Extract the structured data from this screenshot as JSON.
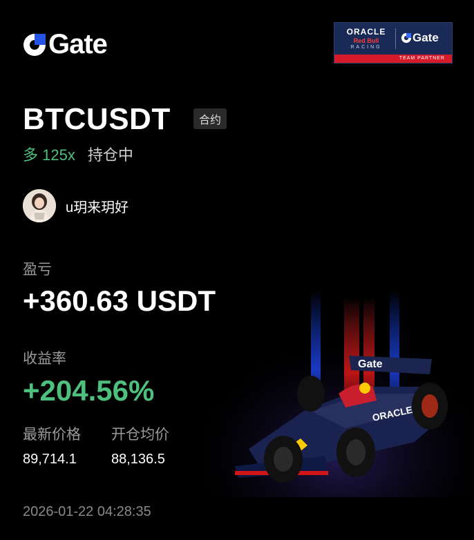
{
  "brand": {
    "logo_text": "Gate"
  },
  "partner_badge": {
    "oracle": "ORACLE",
    "redbull": "Red Bull",
    "racing": "RACING",
    "gate": "Gate",
    "band": "TEAM PARTNER"
  },
  "position": {
    "symbol": "BTCUSDT",
    "type_tag": "合约",
    "direction_leverage": "多 125x",
    "status": "持仓中"
  },
  "user": {
    "name": "u玥来玥好"
  },
  "pnl": {
    "label": "盈亏",
    "value": "+360.63 USDT"
  },
  "roi": {
    "label": "收益率",
    "value": "+204.56%"
  },
  "prices": {
    "latest_label": "最新价格",
    "latest_value": "89,714.1",
    "entry_label": "开仓均价",
    "entry_value": "88,136.5"
  },
  "timestamp": "2026-01-22 04:28:35",
  "colors": {
    "positive": "#4ec07e",
    "gate_blue": "#2354e6",
    "background": "#000000"
  }
}
